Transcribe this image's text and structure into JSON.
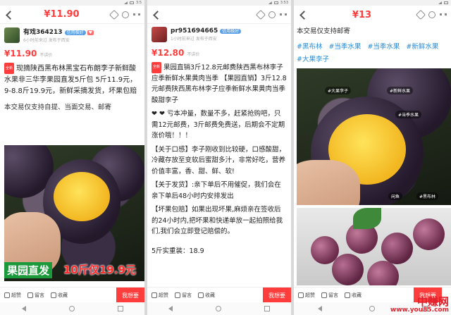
{
  "phone1": {
    "top_price": "¥11.90",
    "seller_name": "有戏364213",
    "seller_badge": "信用极好",
    "seller_sub": "6小时前来过 发布于西安",
    "price": "¥11.90",
    "orig": "不讲价",
    "tag_new": "全新",
    "desc": "现摘陕西黑布林黑宝石布朗李子新鲜酸水果非三华李果园直发5斤包 5斤11.9元，9-8.8斤19.9元，新鲜采摘发货，坏果包赔",
    "note": "本交易仅支持自提、当面交易、邮寄",
    "caption_green": "果园直发",
    "caption_red": "10斤仅19.9元",
    "want": "我想要"
  },
  "phone2": {
    "seller_name": "pr951694665",
    "seller_badge": "信用极好",
    "seller_sub": "1小时前来过 发布于西安",
    "price": "¥12.80",
    "orig": "不讲价",
    "tag_new": "全新",
    "desc": "果园直销3斤12.8元邮费陕西黑布林李子应季新鲜水果黄肉当季 【果园直销】3斤12.8元邮费陕西黑布林李子应季新鲜水果黄肉当季酸甜李子",
    "desc2": "❤ ❤ 亏本冲量，数量不多，赶紧抢购吧，只需12元邮费，3斤邮费免费送，后期会不定期涨价哦！！！",
    "desc3": "【关于口感】李子刚收到比较硬，口感酸甜，冷藏存放至变软后蜜甜多汁，非常好吃，营养价值丰富，香、甜、鲜、软!",
    "desc4": "【关于发货】:亲下单后不用催促，我们会在亲下单后48小时内安排发出",
    "desc5": "【坏果包赔】如果出现坏果,麻烦亲在签收后的24小时内,把坏果和快递单放一起拍照给我们,我们会立即登记赔偿的。",
    "weight": "5斤实重装：18.9",
    "want": "我想要"
  },
  "phone3": {
    "top_price": "¥13",
    "note": "本交易仅支持邮寄",
    "tags": [
      "#黑布林",
      "#当季水果",
      "#当季水果",
      "#新鲜水果",
      "#大果李子"
    ],
    "pill1": "#大果李子",
    "pill2": "#新鲜水果",
    "pill3": "#当季水果",
    "pill4": "闲鱼",
    "pill5": "#黑布林",
    "want": "我想要"
  },
  "common": {
    "like": "超赞",
    "comment": "留言",
    "fav": "收藏",
    "time1": "3:5",
    "time2": "3:53"
  },
  "watermark": {
    "cn": "中赚网",
    "en": "www.you85.com"
  }
}
